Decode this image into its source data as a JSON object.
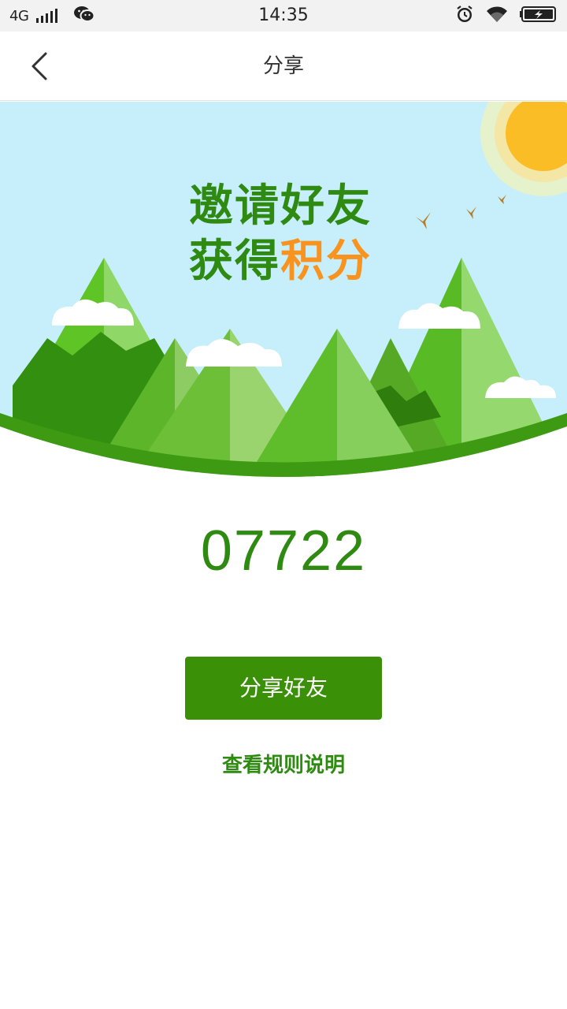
{
  "status_bar": {
    "network": "4G",
    "time": "14:35",
    "icons": [
      "signal-icon",
      "wechat-icon",
      "alarm-icon",
      "wifi-icon",
      "battery-charging-icon"
    ]
  },
  "header": {
    "title": "分享",
    "back_icon": "chevron-left-icon"
  },
  "banner": {
    "headline_line1": "邀请好友",
    "headline_line2_prefix": "获得",
    "headline_line2_accent": "积分",
    "colors": {
      "sky": "#c7eefb",
      "sun": "#fbbd25",
      "headline_green": "#2f8a12",
      "headline_orange": "#f7931e"
    }
  },
  "main": {
    "invite_code": "07722",
    "share_button_label": "分享好友",
    "rules_link_label": "查看规则说明"
  },
  "colors": {
    "primary_green": "#3a9108",
    "text_green": "#2f8a12"
  }
}
